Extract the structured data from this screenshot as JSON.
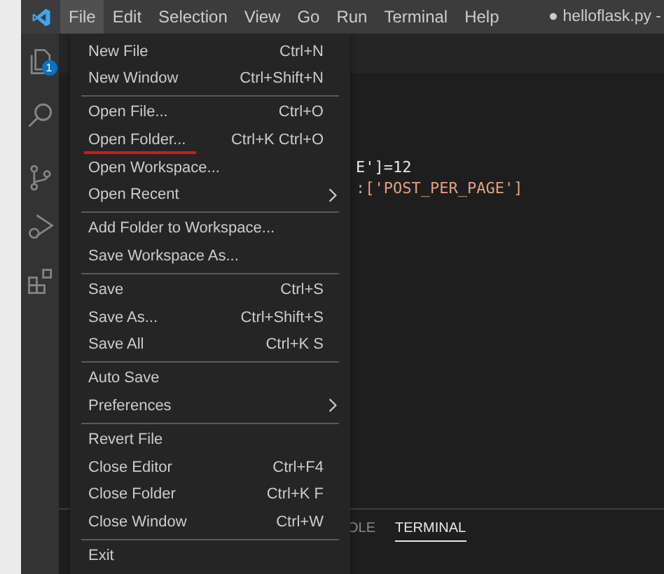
{
  "menubar": [
    {
      "label": "File",
      "selected": true
    },
    {
      "label": "Edit",
      "selected": false
    },
    {
      "label": "Selection",
      "selected": false
    },
    {
      "label": "View",
      "selected": false
    },
    {
      "label": "Go",
      "selected": false
    },
    {
      "label": "Run",
      "selected": false
    },
    {
      "label": "Terminal",
      "selected": false
    },
    {
      "label": "Help",
      "selected": false
    }
  ],
  "title": "● helloflask.py -",
  "activity_bar": [
    {
      "kind": "files",
      "badge": "1"
    },
    {
      "kind": "search"
    },
    {
      "kind": "source-control"
    },
    {
      "kind": "debug"
    },
    {
      "kind": "extensions"
    }
  ],
  "editor": {
    "lines": [
      "E']=12",
      ":['POST_PER_PAGE']"
    ]
  },
  "panel_tabs": [
    {
      "label": "OLE",
      "selected": false
    },
    {
      "label": "TERMINAL",
      "selected": true
    }
  ],
  "file_menu": [
    [
      {
        "label": "New File",
        "shortcut": "Ctrl+N",
        "submenu": false,
        "underlined": false
      },
      {
        "label": "New Window",
        "shortcut": "Ctrl+Shift+N",
        "submenu": false,
        "underlined": false
      }
    ],
    [
      {
        "label": "Open File...",
        "shortcut": "Ctrl+O",
        "submenu": false,
        "underlined": false
      },
      {
        "label": "Open Folder...",
        "shortcut": "Ctrl+K Ctrl+O",
        "submenu": false,
        "underlined": true
      },
      {
        "label": "Open Workspace...",
        "submenu": false,
        "underlined": false
      },
      {
        "label": "Open Recent",
        "submenu": true,
        "underlined": false
      }
    ],
    [
      {
        "label": "Add Folder to Workspace...",
        "submenu": false,
        "underlined": false
      },
      {
        "label": "Save Workspace As...",
        "submenu": false,
        "underlined": false
      }
    ],
    [
      {
        "label": "Save",
        "shortcut": "Ctrl+S",
        "submenu": false,
        "underlined": false
      },
      {
        "label": "Save As...",
        "shortcut": "Ctrl+Shift+S",
        "submenu": false,
        "underlined": false
      },
      {
        "label": "Save All",
        "shortcut": "Ctrl+K S",
        "submenu": false,
        "underlined": false
      }
    ],
    [
      {
        "label": "Auto Save",
        "submenu": false,
        "underlined": false
      },
      {
        "label": "Preferences",
        "submenu": true,
        "underlined": false
      }
    ],
    [
      {
        "label": "Revert File",
        "submenu": false,
        "underlined": false
      },
      {
        "label": "Close Editor",
        "shortcut": "Ctrl+F4",
        "submenu": false,
        "underlined": false
      },
      {
        "label": "Close Folder",
        "shortcut": "Ctrl+K F",
        "submenu": false,
        "underlined": false
      },
      {
        "label": "Close Window",
        "shortcut": "Ctrl+W",
        "submenu": false,
        "underlined": false
      }
    ],
    [
      {
        "label": "Exit",
        "submenu": false,
        "underlined": false
      }
    ]
  ]
}
